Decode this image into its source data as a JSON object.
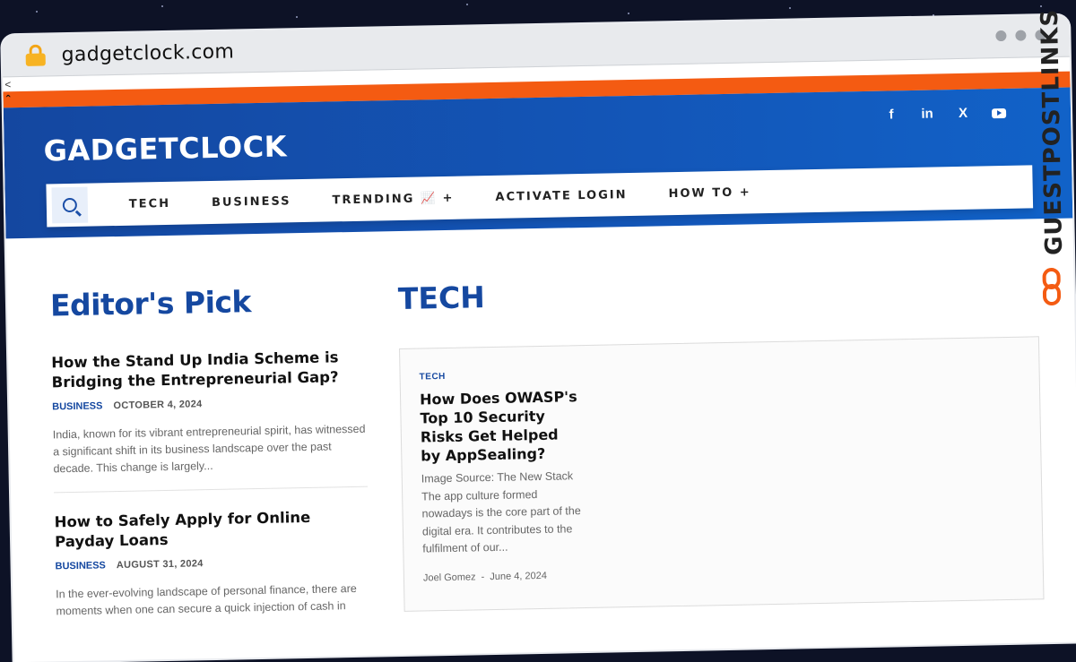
{
  "browser": {
    "url": "gadgetclock.com",
    "back_arrow": "<"
  },
  "site": {
    "logo": "GADGETCLOCK",
    "social": [
      "f",
      "in",
      "X",
      "youtube"
    ]
  },
  "nav": {
    "items": [
      {
        "label": "TECH"
      },
      {
        "label": "BUSINESS"
      },
      {
        "label": "TRENDING 📈 +"
      },
      {
        "label": "ACTIVATE LOGIN"
      },
      {
        "label": "HOW TO +"
      }
    ]
  },
  "editors_pick": {
    "title": "Editor's Pick",
    "articles": [
      {
        "title": "How the Stand Up India Scheme is Bridging the Entrepreneurial Gap?",
        "category": "BUSINESS",
        "date": "OCTOBER 4, 2024",
        "excerpt": "India, known for its vibrant entrepreneurial spirit, has witnessed a significant shift in its business landscape over the past decade. This change is largely..."
      },
      {
        "title": "How to Safely Apply for Online Payday Loans",
        "category": "BUSINESS",
        "date": "AUGUST 31, 2024",
        "excerpt": "In the ever-evolving landscape of personal finance, there are moments when one can secure a quick injection of cash in"
      }
    ]
  },
  "tech": {
    "title": "TECH",
    "card": {
      "category": "TECH",
      "title": "How Does OWASP's Top 10 Security Risks Get Helped by AppSealing?",
      "excerpt": "Image Source: The New Stack The app culture formed nowadays is the core part of the digital era. It contributes to the fulfilment of our...",
      "author": "Joel Gomez",
      "separator": "-",
      "date": "June 4, 2024"
    }
  },
  "watermark": {
    "text": "GUESTPOSTLINKS"
  },
  "colors": {
    "orange": "#f45b12",
    "blue": "#1548a0",
    "header_blue": "#1356b8"
  }
}
